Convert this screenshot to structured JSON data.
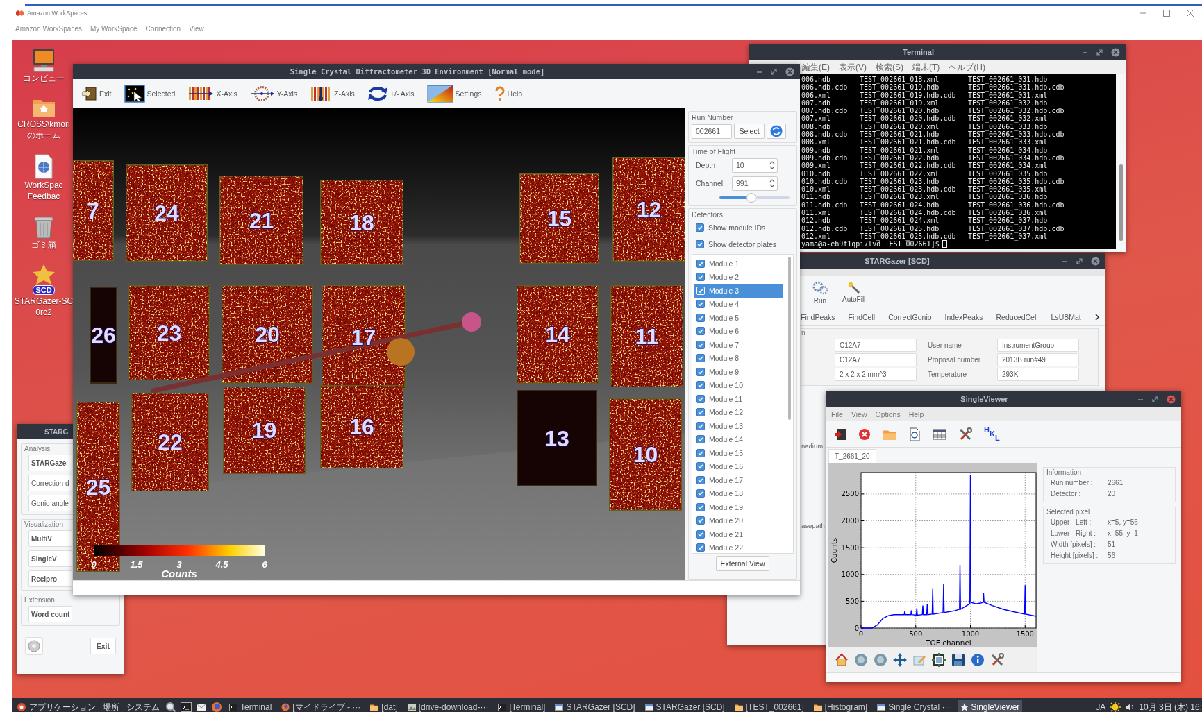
{
  "workspaces": {
    "title": "Amazon WorkSpaces",
    "menu": [
      "Amazon WorkSpaces",
      "My WorkSpace",
      "Connection",
      "View"
    ]
  },
  "desktop_icons": [
    {
      "kind": "computer",
      "lines": [
        "コンピュー"
      ]
    },
    {
      "kind": "home",
      "lines": [
        "CROSS\\kmori",
        "のホーム"
      ]
    },
    {
      "kind": "feedback",
      "lines": [
        "WorkSpac",
        "Feedbac"
      ]
    },
    {
      "kind": "trash",
      "lines": [
        "ゴミ箱"
      ]
    },
    {
      "kind": "app",
      "badge": "SCD",
      "lines": [
        "STARGazer-SC",
        "0rc2"
      ]
    }
  ],
  "launcher": {
    "title": "STARG",
    "groups": [
      {
        "title": "Analysis",
        "buttons": [
          {
            "kind": "app",
            "label": "STARGaze"
          },
          {
            "kind": "tool",
            "label": "Correction d"
          },
          {
            "kind": "tool",
            "label": "Gonio angle"
          }
        ]
      },
      {
        "title": "Visualization",
        "buttons": [
          {
            "kind": "app",
            "label": "MultiV"
          },
          {
            "kind": "app",
            "label": "SingleV"
          },
          {
            "kind": "app",
            "label": "Recipro"
          }
        ]
      },
      {
        "title": "Extension",
        "buttons": [
          {
            "kind": "app",
            "label": "Word count"
          }
        ]
      }
    ],
    "exit": "Exit"
  },
  "terminal": {
    "title": "Terminal",
    "menu": [
      "編集(E)",
      "表示(V)",
      "検索(S)",
      "端末(T)",
      "ヘルプ(H)"
    ],
    "rows": [
      [
        "006.hdb",
        "TEST_002661_018.xml",
        "TEST_002661_031.hdb"
      ],
      [
        "006.hdb.cdb",
        "TEST_002661_019.hdb",
        "TEST_002661_031.hdb.cdb"
      ],
      [
        "006.xml",
        "TEST_002661_019.hdb.cdb",
        "TEST_002661_031.xml"
      ],
      [
        "007.hdb",
        "TEST_002661_019.xml",
        "TEST_002661_032.hdb"
      ],
      [
        "007.hdb.cdb",
        "TEST_002661_020.hdb",
        "TEST_002661_032.hdb.cdb"
      ],
      [
        "007.xml",
        "TEST_002661_020.hdb.cdb",
        "TEST_002661_032.xml"
      ],
      [
        "008.hdb",
        "TEST_002661_020.xml",
        "TEST_002661_033.hdb"
      ],
      [
        "008.hdb.cdb",
        "TEST_002661_021.hdb",
        "TEST_002661_033.hdb.cdb"
      ],
      [
        "008.xml",
        "TEST_002661_021.hdb.cdb",
        "TEST_002661_033.xml"
      ],
      [
        "009.hdb",
        "TEST_002661_021.xml",
        "TEST_002661_034.hdb"
      ],
      [
        "009.hdb.cdb",
        "TEST_002661_022.hdb",
        "TEST_002661_034.hdb.cdb"
      ],
      [
        "009.xml",
        "TEST_002661_022.hdb.cdb",
        "TEST_002661_034.xml"
      ],
      [
        "010.hdb",
        "TEST_002661_022.xml",
        "TEST_002661_035.hdb"
      ],
      [
        "010.hdb.cdb",
        "TEST_002661_023.hdb",
        "TEST_002661_035.hdb.cdb"
      ],
      [
        "010.xml",
        "TEST_002661_023.hdb.cdb",
        "TEST_002661_035.xml"
      ],
      [
        "011.hdb",
        "TEST_002661_023.xml",
        "TEST_002661_036.hdb"
      ],
      [
        "011.hdb.cdb",
        "TEST_002661_024.hdb",
        "TEST_002661_036.hdb.cdb"
      ],
      [
        "011.xml",
        "TEST_002661_024.hdb.cdb",
        "TEST_002661_036.xml"
      ],
      [
        "012.hdb",
        "TEST_002661_024.xml",
        "TEST_002661_037.hdb"
      ],
      [
        "012.hdb.cdb",
        "TEST_002661_025.hdb",
        "TEST_002661_037.hdb.cdb"
      ],
      [
        "012.xml",
        "TEST_002661_025.hdb.cdb",
        "TEST_002661_037.xml"
      ]
    ],
    "prompt": "yama@a-eb9f1qpi7lvd TEST_002661]$"
  },
  "stargazer": {
    "title": "STARGazer [SCD]",
    "tools": [
      {
        "kind": "run",
        "label": "Run"
      },
      {
        "kind": "autofill",
        "label": "AutoFill"
      }
    ],
    "tabs": [
      "FindPeaks",
      "FindCell",
      "CorrectGonio",
      "IndexPeaks",
      "ReducedCell",
      "LsUBMat"
    ],
    "form_title": "n",
    "rows": [
      {
        "value": "C12A7",
        "label": "User name",
        "value2": "InstrumentGroup"
      },
      {
        "value": "C12A7",
        "label": "Proposal number",
        "value2": "2013B run#49"
      },
      {
        "value": "2 x 2 x 2 mm^3",
        "label": "Temperature",
        "value2": "293K"
      }
    ],
    "fragments": [
      "nadium",
      "asepath"
    ]
  },
  "main_window": {
    "title": "Single Crystal Diffractometer 3D Environment [Normal mode]",
    "toolbar": [
      {
        "kind": "exit",
        "label": "Exit"
      },
      {
        "kind": "selected",
        "label": "Selected"
      },
      {
        "kind": "x_axis",
        "label": "X-Axis"
      },
      {
        "kind": "y_axis",
        "label": "Y-Axis"
      },
      {
        "kind": "z_axis",
        "label": "Z-Axis"
      },
      {
        "kind": "pm_axis",
        "label": "+/- Axis"
      },
      {
        "kind": "settings",
        "label": "Settings"
      },
      {
        "kind": "help",
        "label": "Help"
      }
    ],
    "view": {
      "modules": [
        {
          "label": "7",
          "kind": "plate"
        },
        {
          "label": "24",
          "kind": "plate"
        },
        {
          "label": "21",
          "kind": "plate"
        },
        {
          "label": "18",
          "kind": "plate"
        },
        {
          "label": "15",
          "kind": "plate"
        },
        {
          "label": "12",
          "kind": "plate"
        },
        {
          "label": "26",
          "kind": "dark"
        },
        {
          "label": "23",
          "kind": "plate"
        },
        {
          "label": "20",
          "kind": "plate"
        },
        {
          "label": "17",
          "kind": "plate"
        },
        {
          "label": "14",
          "kind": "plate"
        },
        {
          "label": "11",
          "kind": "plate"
        },
        {
          "label": "25",
          "kind": "plate"
        },
        {
          "label": "22",
          "kind": "plate"
        },
        {
          "label": "19",
          "kind": "plate"
        },
        {
          "label": "16",
          "kind": "plate"
        },
        {
          "label": "13",
          "kind": "dark"
        },
        {
          "label": "10",
          "kind": "plate"
        }
      ],
      "colorbar": {
        "ticks": [
          "0",
          "1.5",
          "3",
          "4.5",
          "6"
        ],
        "label": "Counts"
      }
    },
    "run_number": {
      "title": "Run Number",
      "value": "002661",
      "button": "Select"
    },
    "time_of_flight": {
      "title": "Time of Flight",
      "depth_label": "Depth",
      "depth": "10",
      "channel_label": "Channel",
      "channel": "991",
      "level": 0.46
    },
    "detectors": {
      "title": "Detectors",
      "options": [
        {
          "label": "Show module IDs",
          "checked": true
        },
        {
          "label": "Show detector plates",
          "checked": true
        }
      ],
      "modules": [
        {
          "label": "Module 1",
          "checked": true,
          "selected": false
        },
        {
          "label": "Module 2",
          "checked": true,
          "selected": false
        },
        {
          "label": "Module 3",
          "checked": true,
          "selected": true
        },
        {
          "label": "Module 4",
          "checked": true,
          "selected": false
        },
        {
          "label": "Module 5",
          "checked": true,
          "selected": false
        },
        {
          "label": "Module 6",
          "checked": true,
          "selected": false
        },
        {
          "label": "Module 7",
          "checked": true,
          "selected": false
        },
        {
          "label": "Module 8",
          "checked": true,
          "selected": false
        },
        {
          "label": "Module 9",
          "checked": true,
          "selected": false
        },
        {
          "label": "Module 10",
          "checked": true,
          "selected": false
        },
        {
          "label": "Module 11",
          "checked": true,
          "selected": false
        },
        {
          "label": "Module 12",
          "checked": true,
          "selected": false
        },
        {
          "label": "Module 13",
          "checked": true,
          "selected": false
        },
        {
          "label": "Module 14",
          "checked": true,
          "selected": false
        },
        {
          "label": "Module 15",
          "checked": true,
          "selected": false
        },
        {
          "label": "Module 16",
          "checked": true,
          "selected": false
        },
        {
          "label": "Module 17",
          "checked": true,
          "selected": false
        },
        {
          "label": "Module 18",
          "checked": true,
          "selected": false
        },
        {
          "label": "Module 19",
          "checked": true,
          "selected": false
        },
        {
          "label": "Module 20",
          "checked": true,
          "selected": false
        },
        {
          "label": "Module 21",
          "checked": true,
          "selected": false
        },
        {
          "label": "Module 22",
          "checked": true,
          "selected": false
        }
      ]
    },
    "external_view": "External View"
  },
  "single_viewer": {
    "title": "SingleViewer",
    "menu": [
      "File",
      "View",
      "Options",
      "Help"
    ],
    "tools": [
      {
        "kind": "exit"
      },
      {
        "kind": "close"
      },
      {
        "kind": "open"
      },
      {
        "kind": "export"
      },
      {
        "kind": "table"
      },
      {
        "kind": "options"
      },
      {
        "kind": "hkl",
        "text": "HKL"
      }
    ],
    "tab": "T_2661_20",
    "chart_data": {
      "type": "line",
      "xlabel": "TOF channel",
      "ylabel": "Counts",
      "x": [
        0,
        100,
        150,
        200,
        250,
        300,
        350,
        395,
        400,
        405,
        455,
        460,
        465,
        505,
        510,
        515,
        560,
        565,
        570,
        600,
        605,
        610,
        650,
        655,
        660,
        700,
        750,
        755,
        760,
        850,
        900,
        905,
        910,
        950,
        995,
        1000,
        1005,
        1050,
        1100,
        1115,
        1120,
        1125,
        1200,
        1300,
        1400,
        1495,
        1500,
        1505,
        1600
      ],
      "series": [
        {
          "color": "#0000ff",
          "values": [
            0,
            0,
            60,
            180,
            230,
            250,
            250,
            250,
            320,
            250,
            250,
            330,
            250,
            240,
            370,
            240,
            250,
            420,
            250,
            250,
            440,
            250,
            260,
            730,
            260,
            270,
            290,
            820,
            290,
            320,
            350,
            1180,
            350,
            400,
            450,
            2850,
            480,
            450,
            470,
            480,
            650,
            480,
            420,
            350,
            300,
            260,
            800,
            260,
            220
          ]
        }
      ],
      "xlim": [
        0,
        1600
      ],
      "ylim": [
        0,
        2900
      ],
      "grid": true,
      "xticks": [
        0,
        500,
        1000,
        1500
      ],
      "yticks": [
        0,
        500,
        1000,
        1500,
        2000,
        2500
      ]
    },
    "information": {
      "title": "Information",
      "rows": [
        {
          "label": "Run number :",
          "value": "2661"
        },
        {
          "label": "Detector :",
          "value": "20"
        }
      ]
    },
    "selected_pixel": {
      "title": "Selected pixel",
      "rows": [
        {
          "label": "Upper - Left :",
          "value": "x=5, y=56"
        },
        {
          "label": "Lower - Right :",
          "value": "x=55, y=1"
        },
        {
          "label": "Width [pixels] :",
          "value": "51"
        },
        {
          "label": "Height [pixels] :",
          "value": "56"
        }
      ]
    }
  },
  "taskbar": {
    "menus": [
      {
        "kind": "apps",
        "label": "アプリケーション"
      },
      {
        "kind": "places",
        "label": "場所"
      },
      {
        "kind": "system",
        "label": "システム"
      }
    ],
    "tasks": [
      {
        "kind": "terminal",
        "label": "Terminal",
        "selected": false
      },
      {
        "kind": "browser",
        "label": "[マイドライブ - ···",
        "selected": false
      },
      {
        "kind": "folder",
        "label": "[dat]",
        "selected": false
      },
      {
        "kind": "image",
        "label": "[drive-download-···",
        "selected": false
      },
      {
        "kind": "terminal",
        "label": "[Terminal]",
        "selected": false
      },
      {
        "kind": "window",
        "label": "STARGazer [SCD]",
        "selected": false
      },
      {
        "kind": "window",
        "label": "STARGazer [SCD]",
        "selected": false
      },
      {
        "kind": "folder",
        "label": "[TEST_002661]",
        "selected": false
      },
      {
        "kind": "folder",
        "label": "[Histogram]",
        "selected": false
      },
      {
        "kind": "window",
        "label": "Single Crystal ···",
        "selected": false
      },
      {
        "kind": "viewer",
        "label": "SingleViewer",
        "selected": true
      }
    ],
    "lang": "JA",
    "clock": "10月 3日 (木) 16:"
  }
}
